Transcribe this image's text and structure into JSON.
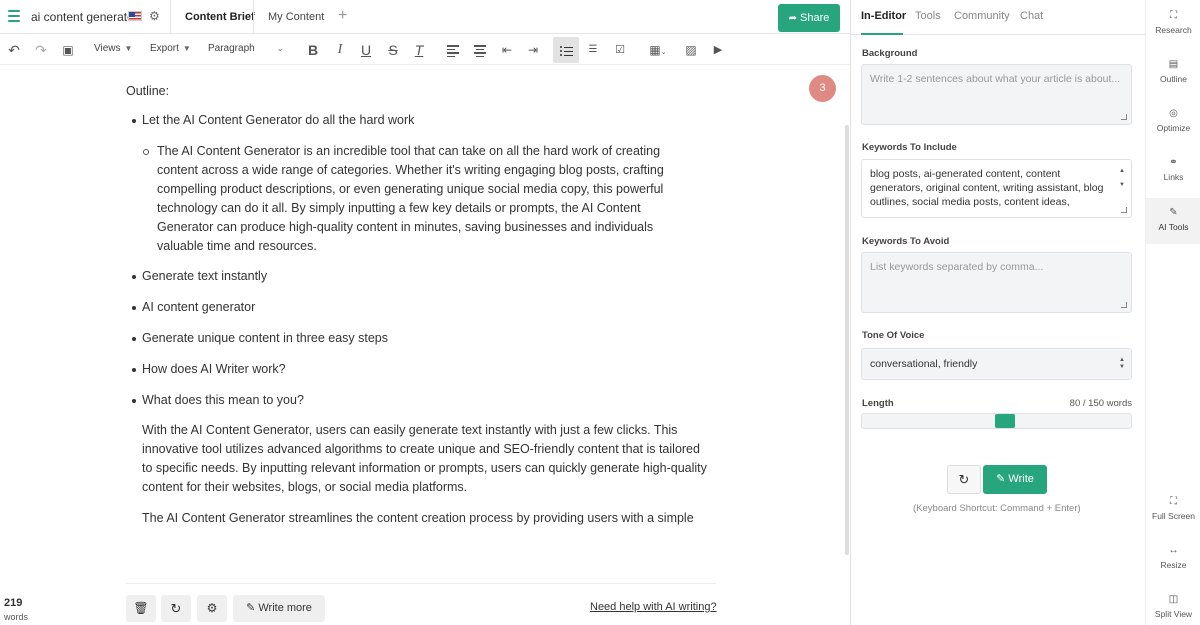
{
  "topbar": {
    "doc_title": "ai content generator",
    "tabs": [
      "Content Brief",
      "My Content"
    ],
    "add_tab": "+",
    "share_label": "Share"
  },
  "toolbar": {
    "views_label": "Views",
    "export_label": "Export",
    "paragraph_label": "Paragraph",
    "bold": "B",
    "italic": "I",
    "underline": "U",
    "strike": "S",
    "clear_format": "T"
  },
  "editor": {
    "outline_label": "Outline:",
    "badge_count": "3",
    "bullets": [
      "Let the AI Content Generator do all the hard work",
      "Generate text instantly",
      "AI content generator",
      "Generate unique content in three easy steps",
      "How does AI Writer work?",
      "What does this mean to you?"
    ],
    "sub_paragraph": "The AI Content Generator is an incredible tool that can take on all the hard work of creating content across a wide range of categories. Whether it's writing engaging blog posts, crafting compelling product descriptions, or even generating unique social media copy, this powerful technology can do it all. By simply inputting a few key details or prompts, the AI Content Generator can produce high-quality content in minutes, saving businesses and individuals valuable time and resources.",
    "paragraph_1": "With the AI Content Generator, users can easily generate text instantly with just a few clicks. This innovative tool utilizes advanced algorithms to create unique and SEO-friendly content that is tailored to specific needs. By inputting relevant information or prompts, users can quickly generate high-quality content for their websites, blogs, or social media platforms.",
    "paragraph_2": "The AI Content Generator streamlines the content creation process by providing users with a simple"
  },
  "editor_footer": {
    "write_more_label": "Write more",
    "help_link": "Need help with AI writing?",
    "word_count": "219",
    "word_label": "words"
  },
  "panel": {
    "tabs": [
      "In-Editor",
      "Tools",
      "Community",
      "Chat"
    ],
    "background_label": "Background",
    "background_placeholder": "Write 1-2 sentences about what your article is about...",
    "keywords_include_label": "Keywords To Include",
    "keywords_include_value": "blog posts, ai-generated content, content generators, original content, writing assistant, blog outlines, social media posts, content ideas,",
    "keywords_avoid_label": "Keywords To Avoid",
    "keywords_avoid_placeholder": "List keywords separated by comma...",
    "tone_label": "Tone Of Voice",
    "tone_value": "conversational, friendly",
    "length_label": "Length",
    "length_value": "80 / 150 words",
    "length_fraction": 0.533,
    "write_label": "Write",
    "shortcut_note": "(Keyboard Shortcut: Command + Enter)"
  },
  "rail": {
    "top_items": [
      "Research",
      "Outline",
      "Optimize",
      "Links",
      "AI Tools"
    ],
    "bottom_items": [
      "Full Screen",
      "Resize",
      "Split View"
    ]
  },
  "colors": {
    "accent": "#27a67d",
    "badge": "#e08a84"
  }
}
